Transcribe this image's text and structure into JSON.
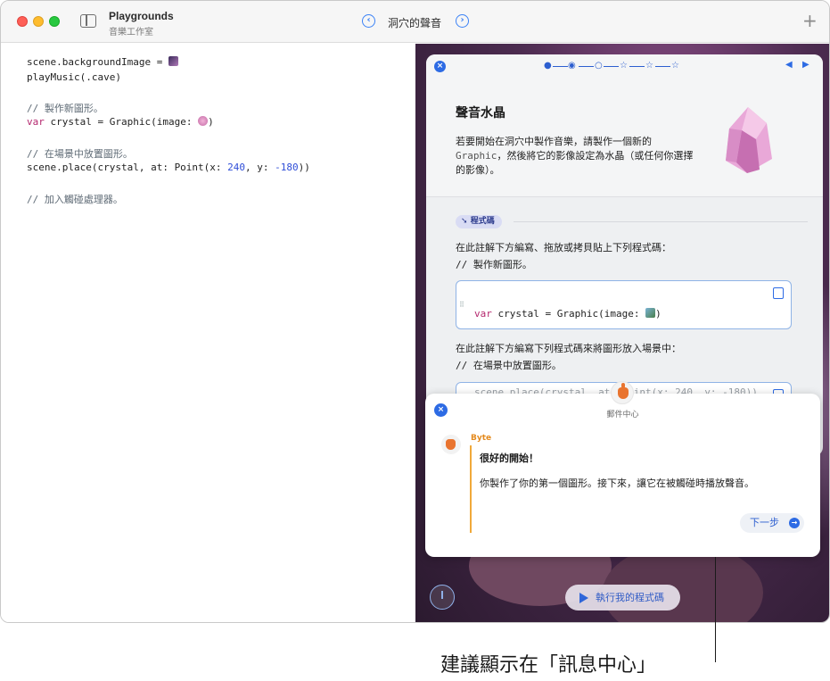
{
  "window": {
    "app_title": "Playgrounds",
    "app_subtitle": "音樂工作室",
    "page_title": "洞穴的聲音",
    "prev_label": "‹",
    "next_label": "›",
    "add_label": "+"
  },
  "editor": {
    "lines": [
      "scene.backgroundImage = ",
      "playMusic(.cave)",
      "// 製作新圖形。",
      "var",
      " crystal = Graphic(image: ",
      ")",
      "// 在場景中放置圖形。",
      "scene.place(crystal, at: Point(x: ",
      "240",
      ", y: ",
      "-180",
      "))",
      "// 加入觸碰處理器。"
    ]
  },
  "guide": {
    "close_label": "×",
    "progress": {
      "current_step": 2,
      "total_steps": 6
    },
    "step_glyphs": [
      "●",
      "◉",
      "○",
      "☆",
      "☆",
      "☆"
    ],
    "prev_arrow": "◀",
    "next_arrow": "▶",
    "title": "聲音水晶",
    "body_1": "若要開始在洞穴中製作音樂，請製作一個新的",
    "body_2": "Graphic",
    "body_3": "，然後將它的影像設定為水晶（或任何你選擇的影像）。",
    "badge": "程式碼",
    "instruction_1": "在此註解下方編寫、拖放或拷貝貼上下列程式碼：",
    "comment_1": "// 製作新圖形。",
    "code_kw": "var",
    "code_1": " crystal = Graphic(image: ",
    "code_1_end": ")",
    "instruction_2": "在此註解下方編寫下列程式碼來將圖形放入場景中：",
    "comment_2": "// 在場景中放置圖形。",
    "code_2": "scene.place(crystal, at: Point(x: 240, y: -180))"
  },
  "inbox": {
    "close_label": "×",
    "title": "郵件中心",
    "sender": "Byte",
    "headline": "很好的開始！",
    "message": "你製作了你的第一個圖形。接下來，讓它在被觸碰時播放聲音。",
    "next_button": "下一步",
    "next_arrow": "→"
  },
  "run_button": {
    "label": "執行我的程式碼"
  },
  "callout": {
    "text": "建議顯示在「訊息中心」"
  },
  "colors": {
    "accent": "#2d6be4",
    "keyword": "#b4276e",
    "number": "#2f4ed8",
    "byte_orange": "#e48a1e"
  },
  "icons": [
    "sidebar-icon",
    "chevron-left-icon",
    "chevron-right-icon",
    "plus-icon",
    "close-icon",
    "copy-icon",
    "play-icon",
    "meter-icon",
    "crystal-icon",
    "byte-avatar-icon"
  ]
}
